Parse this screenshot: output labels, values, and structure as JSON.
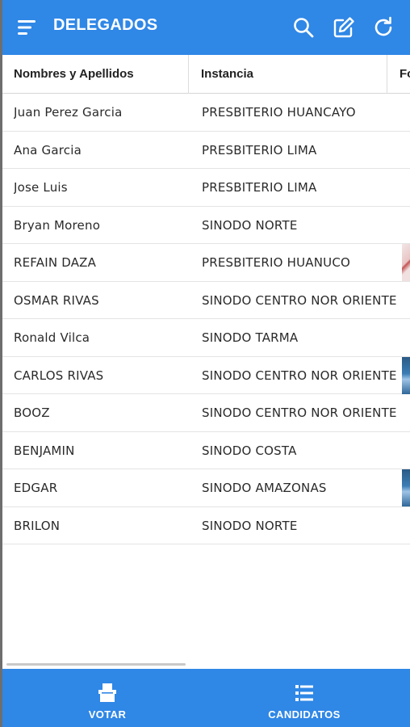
{
  "app": {
    "title": "DELEGADOS",
    "accent": "#2f87e6",
    "icons": [
      "menu-icon",
      "search-icon",
      "edit-icon",
      "refresh-icon"
    ]
  },
  "table": {
    "headers": [
      "Nombres y Apellidos",
      "Instancia",
      "Fo"
    ],
    "rows": [
      {
        "name": "Juan Perez Garcia",
        "instance": "PRESBITERIO HUANCAYO",
        "photo": ""
      },
      {
        "name": "Ana Garcia",
        "instance": "PRESBITERIO LIMA",
        "photo": ""
      },
      {
        "name": "Jose Luis",
        "instance": "PRESBITERIO LIMA",
        "photo": ""
      },
      {
        "name": "Bryan Moreno",
        "instance": "SINODO NORTE",
        "photo": ""
      },
      {
        "name": "REFAIN DAZA",
        "instance": "PRESBITERIO HUANUCO",
        "photo": "pink"
      },
      {
        "name": "OSMAR RIVAS",
        "instance": "SINODO CENTRO NOR ORIENTE",
        "photo": ""
      },
      {
        "name": "Ronald Vilca",
        "instance": "SINODO TARMA",
        "photo": ""
      },
      {
        "name": "CARLOS RIVAS",
        "instance": "SINODO CENTRO NOR ORIENTE",
        "photo": "blue"
      },
      {
        "name": "BOOZ",
        "instance": "SINODO CENTRO NOR ORIENTE",
        "photo": ""
      },
      {
        "name": "BENJAMIN",
        "instance": "SINODO COSTA",
        "photo": ""
      },
      {
        "name": "EDGAR",
        "instance": "SINODO AMAZONAS",
        "photo": "blue"
      },
      {
        "name": "BRILON",
        "instance": "SINODO NORTE",
        "photo": ""
      }
    ]
  },
  "bottom_nav": {
    "items": [
      {
        "label": "VOTAR",
        "icon": "ballot-box-icon"
      },
      {
        "label": "CANDIDATOS",
        "icon": "list-icon"
      }
    ]
  }
}
